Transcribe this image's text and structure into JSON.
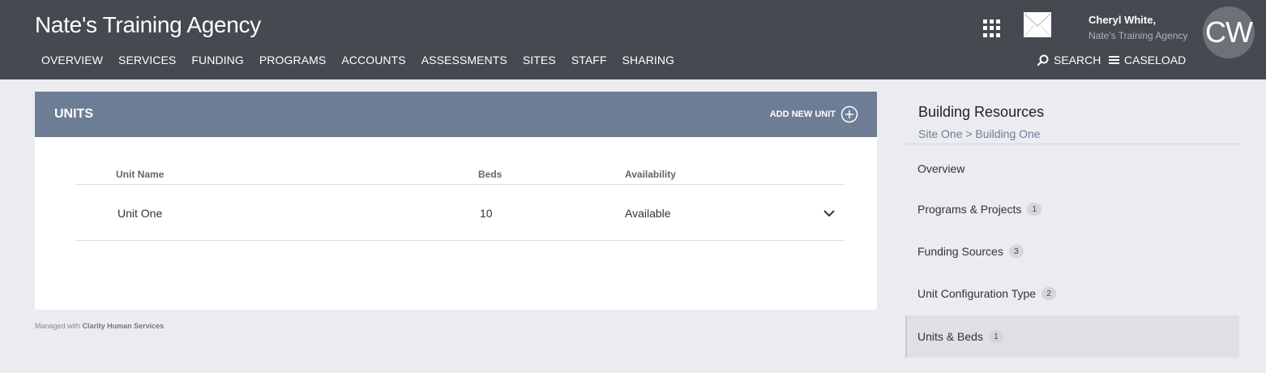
{
  "header": {
    "brand": "Nate's Training Agency",
    "nav": [
      "OVERVIEW",
      "SERVICES",
      "FUNDING",
      "PROGRAMS",
      "ACCOUNTS",
      "ASSESSMENTS",
      "SITES",
      "STAFF",
      "SHARING"
    ],
    "user_name": "Cheryl White,",
    "user_org": "Nate's Training Agency",
    "avatar_initials": "CW",
    "search_label": "SEARCH",
    "caseload_label": "CASELOAD",
    "icons": [
      "apps-grid-icon",
      "mail-icon",
      "search-icon",
      "menu-icon"
    ]
  },
  "units": {
    "title": "UNITS",
    "add_label": "ADD NEW UNIT",
    "columns": [
      "Unit Name",
      "Beds",
      "Availability"
    ],
    "rows": [
      {
        "name": "Unit One",
        "beds": "10",
        "availability": "Available"
      }
    ]
  },
  "footer": {
    "prefix": "Managed with",
    "brand": "Clarity Human Services"
  },
  "sidebar": {
    "title": "Building Resources",
    "breadcrumb": "Site One > Building One",
    "items": [
      {
        "label": "Overview",
        "count": null
      },
      {
        "label": "Programs & Projects",
        "count": "1"
      },
      {
        "label": "Funding Sources",
        "count": "3"
      },
      {
        "label": "Unit Configuration Type",
        "count": "2"
      },
      {
        "label": "Units & Beds",
        "count": "1",
        "active": true
      }
    ]
  },
  "colors": {
    "topbar": "#454950",
    "panel_header": "#6e7d96",
    "page_bg": "#ebecf0"
  }
}
